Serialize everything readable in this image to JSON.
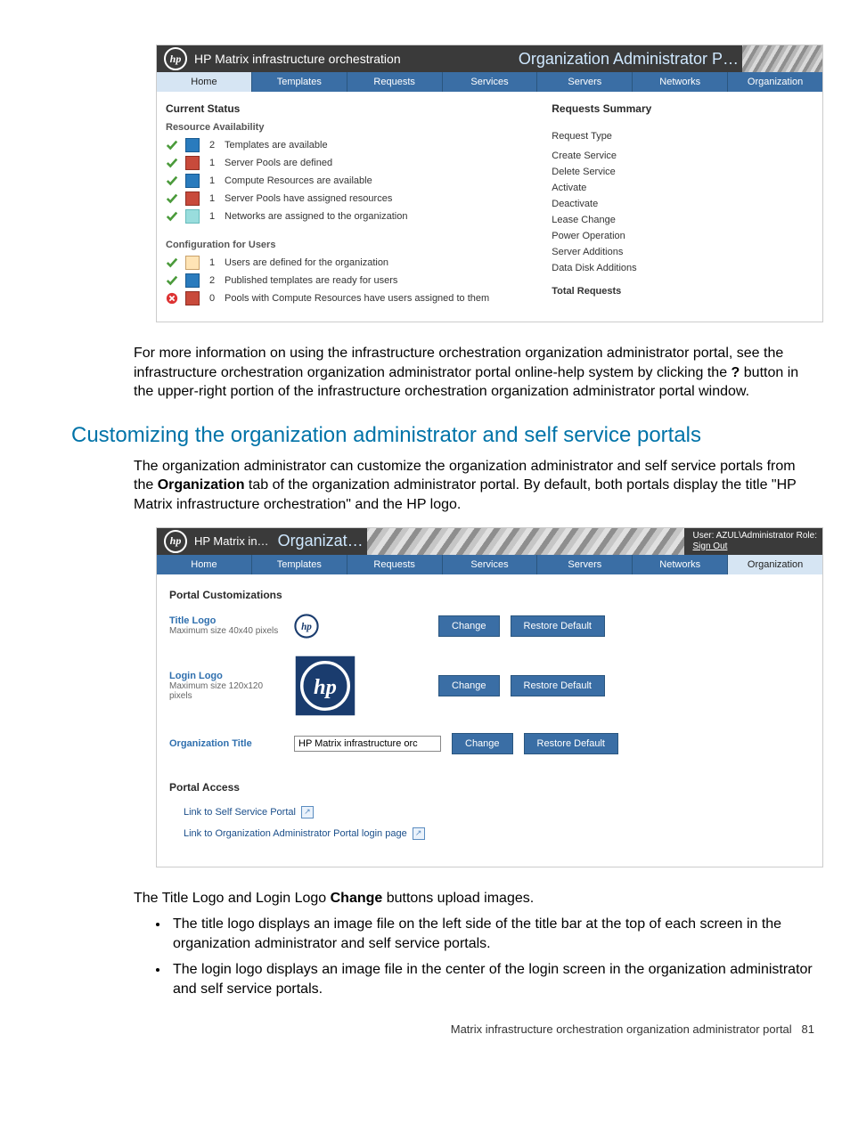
{
  "shot1": {
    "title_left": "HP Matrix infrastructure orchestration",
    "title_right": "Organization Administrator P…",
    "tabs": [
      "Home",
      "Templates",
      "Requests",
      "Services",
      "Servers",
      "Networks",
      "Organization"
    ],
    "current_status": "Current Status",
    "resource_availability": "Resource Availability",
    "config_for_users": "Configuration for Users",
    "res_rows": [
      {
        "count": "2",
        "text": "Templates are available",
        "mini": "blue"
      },
      {
        "count": "1",
        "text": "Server Pools are defined",
        "mini": "red"
      },
      {
        "count": "1",
        "text": "Compute Resources are available",
        "mini": "blue"
      },
      {
        "count": "1",
        "text": "Server Pools have assigned resources",
        "mini": "red"
      },
      {
        "count": "1",
        "text": "Networks are assigned to the organization",
        "mini": "cyan"
      }
    ],
    "cfg_rows": [
      {
        "status": "ok",
        "count": "1",
        "text": "Users are defined for the organization",
        "mini": "user"
      },
      {
        "status": "ok",
        "count": "2",
        "text": "Published templates are ready for users",
        "mini": "blue"
      },
      {
        "status": "err",
        "count": "0",
        "text": "Pools with Compute Resources have users assigned to them",
        "mini": "red"
      }
    ],
    "requests_summary": "Requests Summary",
    "request_type": "Request Type",
    "req_items": [
      "Create Service",
      "Delete Service",
      "Activate",
      "Deactivate",
      "Lease Change",
      "Power Operation",
      "Server Additions",
      "Data Disk Additions"
    ],
    "total_requests": "Total Requests"
  },
  "para1a": "For more information on using the infrastructure orchestration organization administrator portal, see the infrastructure orchestration organization administrator portal online-help system by clicking the ",
  "para1b": "?",
  "para1c": " button in the upper-right portion of the infrastructure orchestration organization administrator portal window.",
  "heading": "Customizing the organization administrator and self service portals",
  "para2a": "The organization administrator can customize the organization administrator and self service portals from the ",
  "para2b": "Organization",
  "para2c": " tab of the organization administrator portal. By default, both portals display the title \"HP Matrix infrastructure orchestration\" and the HP logo.",
  "shot2": {
    "title_left": "HP Matrix in…",
    "title_right": "Organizat…",
    "user_line": "User: AZUL\\Administrator     Role:",
    "sign_out": "Sign Out",
    "tabs": [
      "Home",
      "Templates",
      "Requests",
      "Services",
      "Servers",
      "Networks",
      "Organization"
    ],
    "portal_customizations": "Portal Customizations",
    "title_logo": "Title Logo",
    "title_logo_sub": "Maximum size 40x40 pixels",
    "login_logo": "Login Logo",
    "login_logo_sub": "Maximum size 120x120 pixels",
    "org_title": "Organization Title",
    "org_title_value": "HP Matrix infrastructure orc",
    "change": "Change",
    "restore_default": "Restore Default",
    "portal_access": "Portal Access",
    "link1": "Link to Self Service Portal",
    "link2": "Link to Organization Administrator Portal login page"
  },
  "para3a": "The Title Logo and Login Logo ",
  "para3b": "Change",
  "para3c": " buttons upload images.",
  "bullet1": "The title logo displays an image file on the left side of the title bar at the top of each screen in the organization administrator and self service portals.",
  "bullet2": "The login logo displays an image file in the center of the login screen in the organization administrator and self service portals.",
  "footer_text": "Matrix infrastructure orchestration organization administrator portal",
  "footer_page": "81"
}
